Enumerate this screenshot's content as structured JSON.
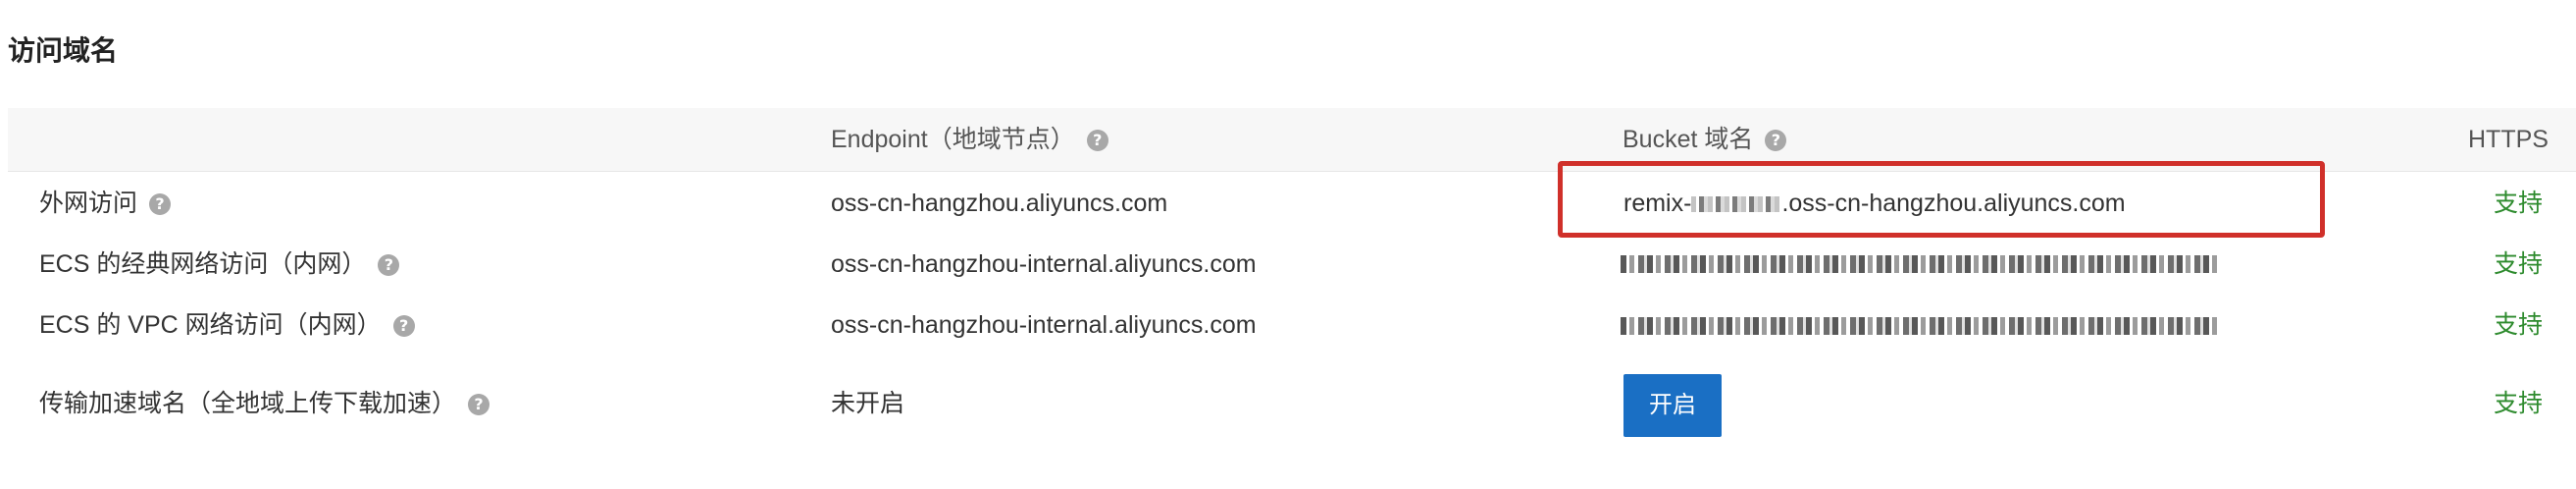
{
  "section": {
    "title": "访问域名"
  },
  "table": {
    "headers": {
      "endpoint": "Endpoint（地域节点）",
      "bucket_domain": "Bucket 域名",
      "https": "HTTPS"
    },
    "rows": [
      {
        "name": "外网访问",
        "endpoint": "oss-cn-hangzhou.aliyuncs.com",
        "bucket_prefix": "remix-",
        "bucket_suffix": ".oss-cn-hangzhou.aliyuncs.com",
        "https": "支持"
      },
      {
        "name": "ECS 的经典网络访问（内网）",
        "endpoint": "oss-cn-hangzhou-internal.aliyuncs.com",
        "https": "支持"
      },
      {
        "name": "ECS 的 VPC 网络访问（内网）",
        "endpoint": "oss-cn-hangzhou-internal.aliyuncs.com",
        "https": "支持"
      },
      {
        "name": "传输加速域名（全地域上传下载加速）",
        "endpoint": "未开启",
        "button": "开启",
        "https": "支持"
      }
    ]
  },
  "icons": {
    "help": "?"
  },
  "colors": {
    "support_green": "#2e8b2e",
    "button_blue": "#1a6fc4",
    "highlight_red": "#d0302a",
    "header_bg": "#f7f7f7"
  }
}
